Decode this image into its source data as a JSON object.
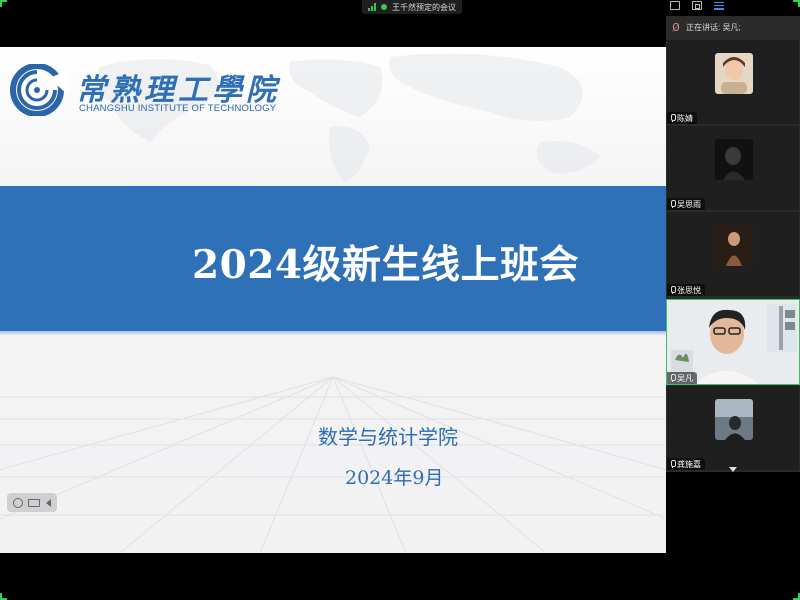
{
  "meeting": {
    "title": "王千然预定的会议"
  },
  "slide": {
    "school_name_cn": "常熟理工學院",
    "school_name_en": "CHANGSHU INSTITUTE OF TECHNOLOGY",
    "title": "2024级新生线上班会",
    "department": "数学与统计学院",
    "date": "2024年9月"
  },
  "panel": {
    "speaking_label": "正在讲话: 吴凡;",
    "participants": [
      {
        "name": "陈婧",
        "icon": "mic-icon"
      },
      {
        "name": "吴思雨",
        "icon": "mic-icon"
      },
      {
        "name": "张思悦",
        "icon": "mic-icon"
      },
      {
        "name": "吴凡",
        "icon": "mic-icon",
        "active": true
      },
      {
        "name": "龚施嘉",
        "icon": "mic-icon"
      }
    ]
  },
  "colors": {
    "brand_blue": "#2e71b6",
    "active_green": "#3fbf63"
  }
}
